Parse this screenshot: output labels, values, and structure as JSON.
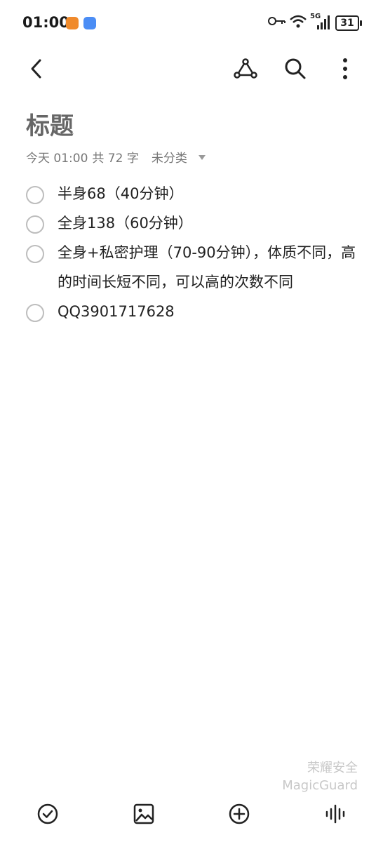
{
  "status_bar": {
    "time": "01:00",
    "network": "5G",
    "battery": "31"
  },
  "toolbar": {
    "icons": [
      "back-icon",
      "share-icon",
      "search-icon",
      "more-icon"
    ]
  },
  "note": {
    "title": "标题",
    "date": "今天 01:00",
    "word_count": "共 72 字",
    "category": "未分类"
  },
  "checklist": [
    {
      "text": "半身68（40分钟）",
      "checked": false
    },
    {
      "text": "全身138（60分钟）",
      "checked": false
    },
    {
      "text": "全身+私密护理（70-90分钟），体质不同，高的时间长短不同，可以高的次数不同",
      "checked": false
    },
    {
      "text": "QQ3901717628",
      "checked": false
    }
  ],
  "watermark": {
    "line1": "荣耀安全",
    "line2": "MagicGuard"
  },
  "bottom_bar": {
    "icons": [
      "checklist-icon",
      "image-icon",
      "add-icon",
      "voice-icon"
    ]
  },
  "colors": {
    "accent_orange": "#f08a2b",
    "accent_blue": "#4b8df5"
  }
}
